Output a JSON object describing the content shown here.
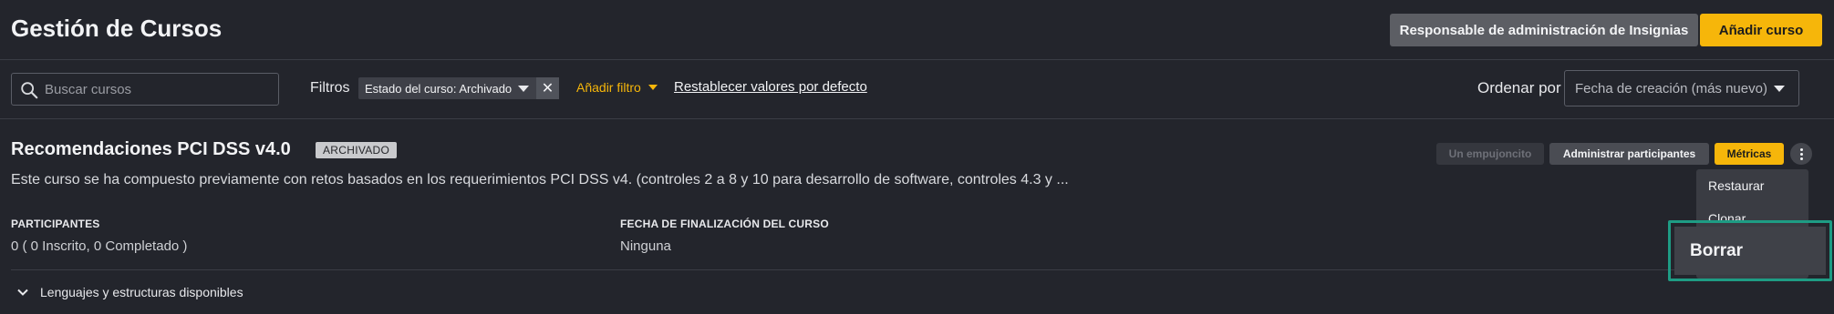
{
  "header": {
    "title": "Gestión de Cursos",
    "badge_admin_label": "Responsable de administración de Insignias",
    "add_course_label": "Añadir curso"
  },
  "filters": {
    "search_placeholder": "Buscar cursos",
    "filters_label": "Filtros",
    "active_filter": "Estado del curso: Archivado",
    "add_filter_label": "Añadir filtro",
    "reset_label": "Restablecer valores por defecto",
    "sort_label": "Ordenar por",
    "sort_value": "Fecha de creación (más nuevo)"
  },
  "course": {
    "title": "Recomendaciones PCI DSS v4.0",
    "status": "ARCHIVADO",
    "description": "Este curso se ha compuesto previamente con retos basados en los requerimientos PCI DSS v4. (controles 2 a 8 y 10 para desarrollo de software, controles 4.3 y ...",
    "nudge_label": "Un empujoncito",
    "participants_button_label": "Administrar participantes",
    "metrics_label": "Métricas",
    "participants_heading": "PARTICIPANTES",
    "participants_value": "0 ( 0 Inscrito, 0 Completado )",
    "end_date_heading": "FECHA DE FINALIZACIÓN DEL CURSO",
    "end_date_value": "Ninguna",
    "languages_label": "Lenguajes y estructuras disponibles"
  },
  "menu": {
    "items": [
      "Restaurar",
      "Clonar",
      "Borrar"
    ]
  },
  "colors": {
    "accent": "#f6b60a",
    "highlight": "#1e9c84",
    "background": "#23252c"
  }
}
